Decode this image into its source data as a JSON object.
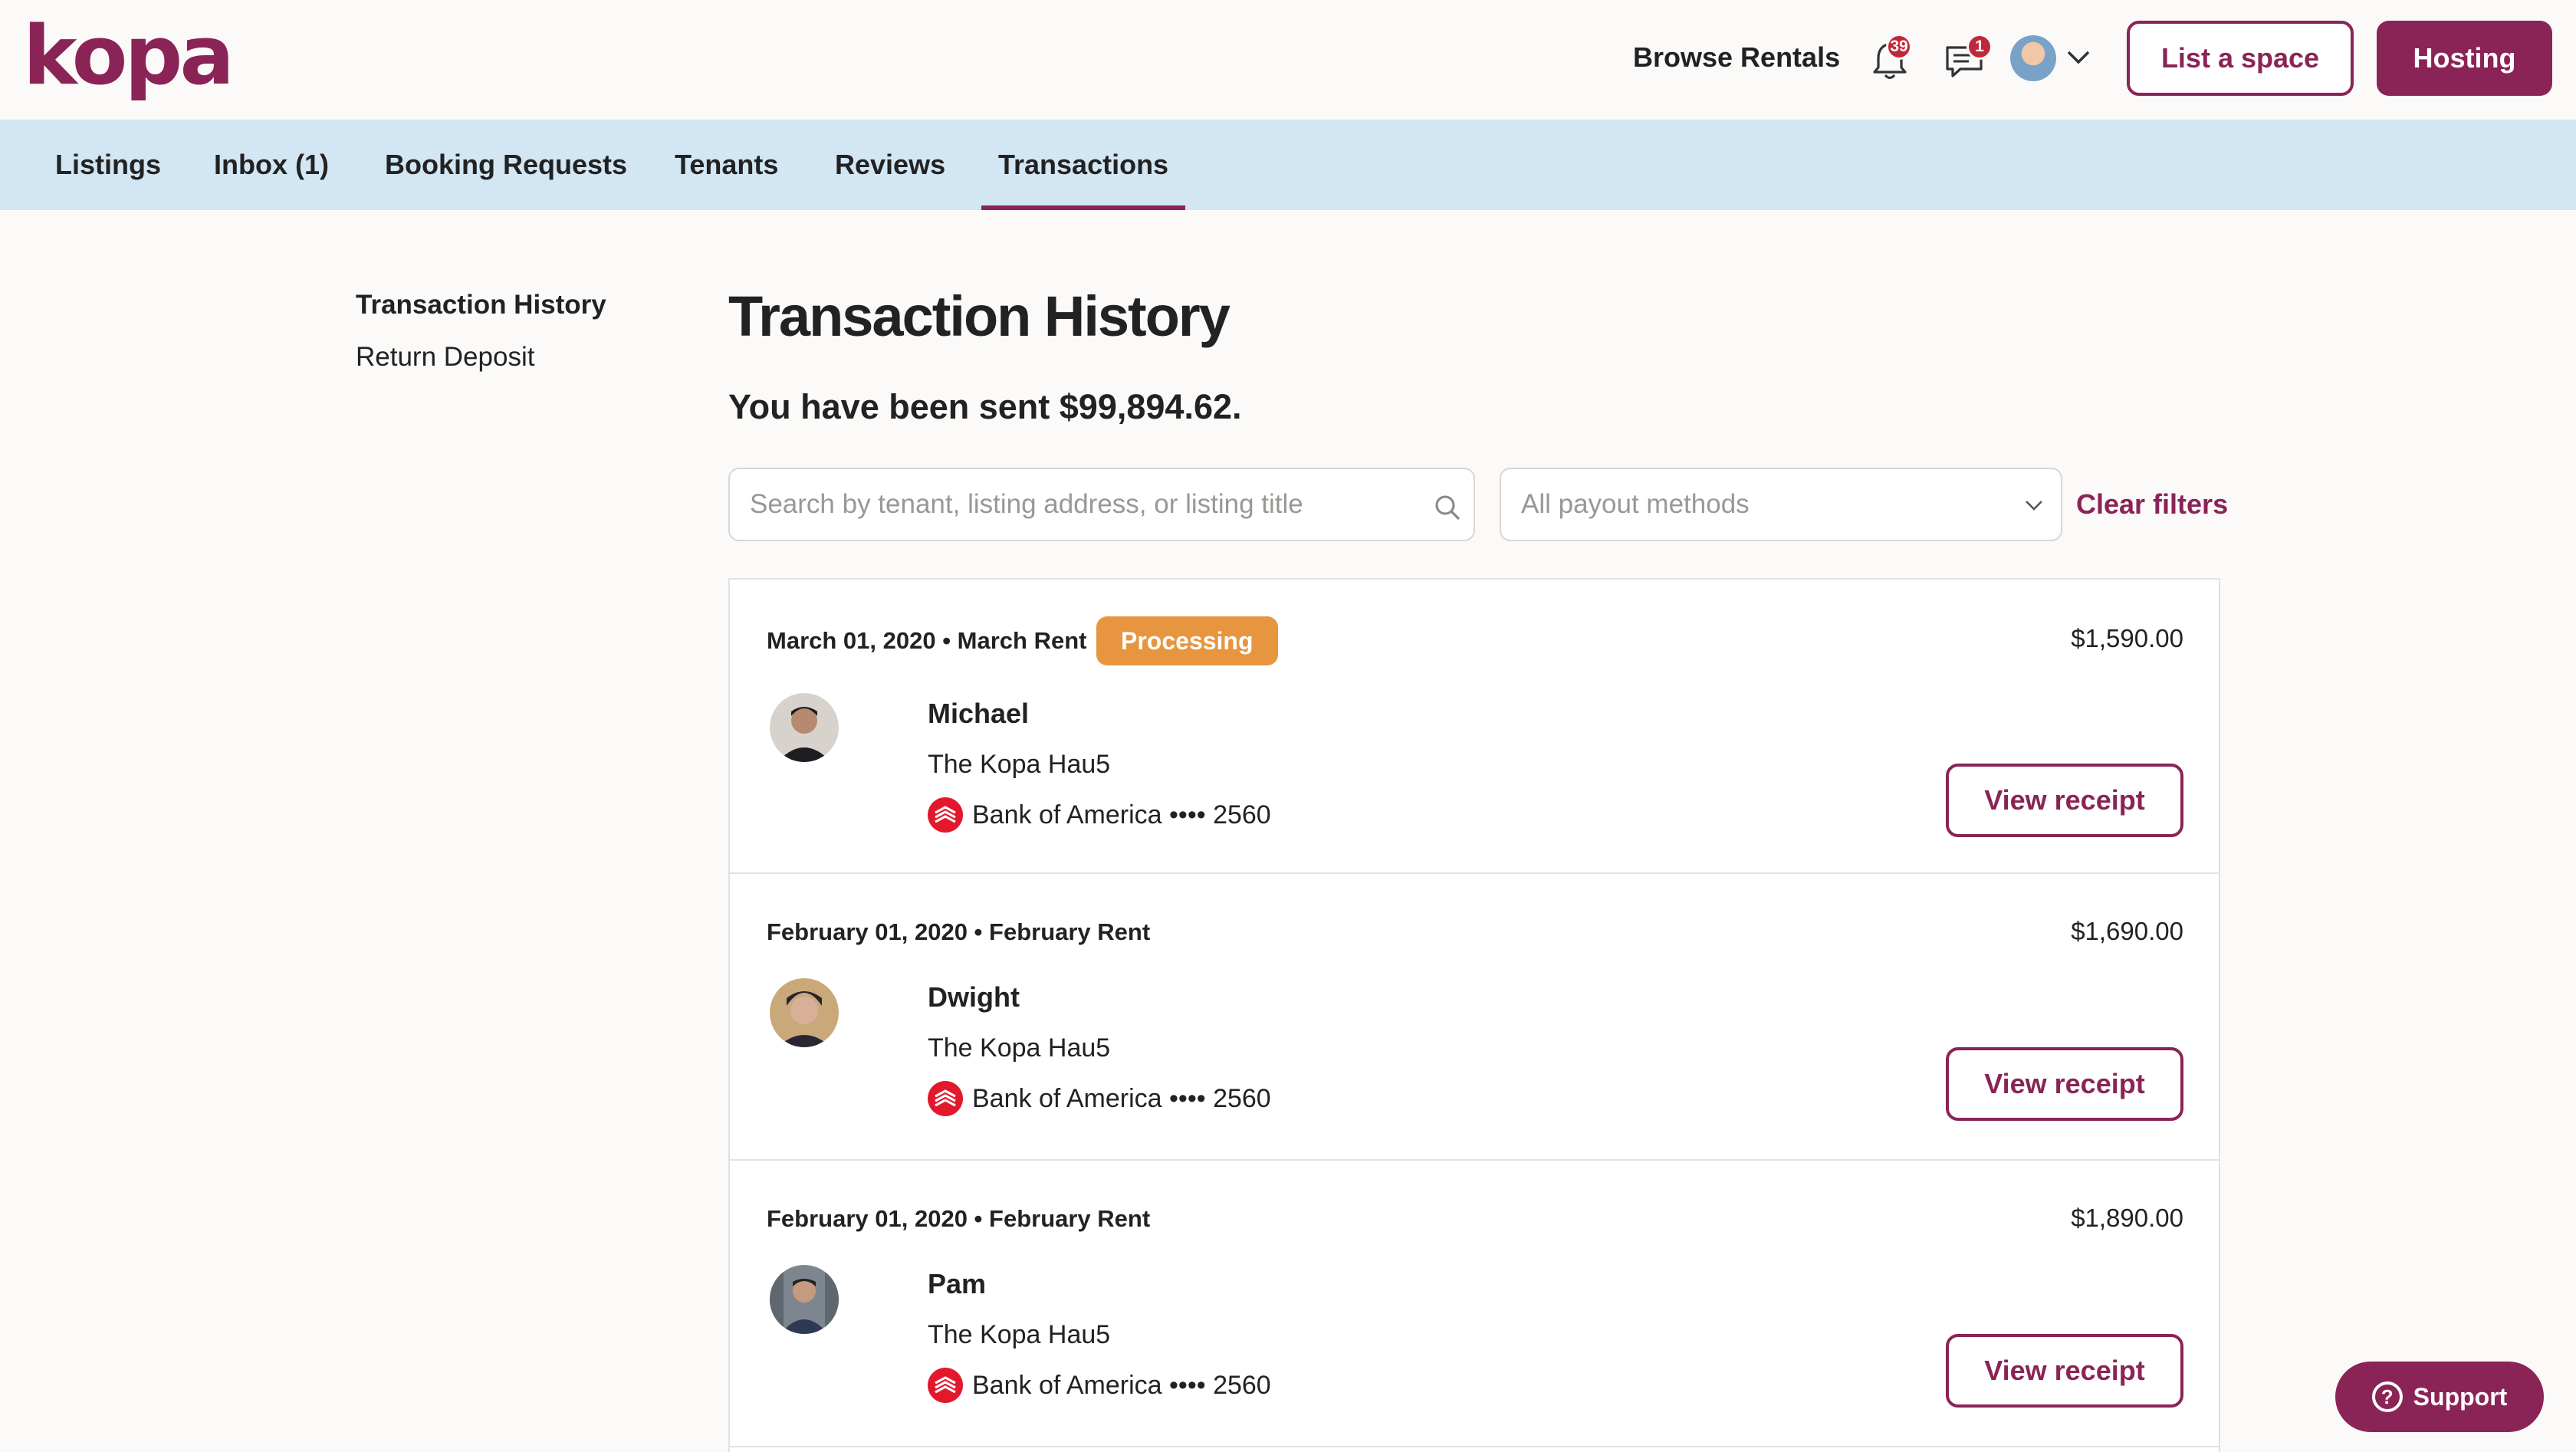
{
  "brand": {
    "logo_text": "kopa",
    "accent": "#8a2456"
  },
  "header": {
    "browse_label": "Browse Rentals",
    "notifications_count": "39",
    "messages_count": "1",
    "list_space_label": "List a space",
    "hosting_label": "Hosting"
  },
  "nav": {
    "tabs": [
      {
        "label": "Listings"
      },
      {
        "label": "Inbox (1)"
      },
      {
        "label": "Booking Requests"
      },
      {
        "label": "Tenants"
      },
      {
        "label": "Reviews"
      },
      {
        "label": "Transactions"
      }
    ],
    "active": "Transactions"
  },
  "sidebar": {
    "items": [
      {
        "label": "Transaction History"
      },
      {
        "label": "Return Deposit"
      }
    ]
  },
  "main": {
    "title": "Transaction History",
    "sent_summary": "You have been sent $99,894.62.",
    "search_placeholder": "Search by tenant, listing address, or listing title",
    "payout_select_value": "All payout methods",
    "clear_filters_label": "Clear filters"
  },
  "transactions": [
    {
      "meta": "March 01, 2020 • March Rent",
      "status": "Processing",
      "amount": "$1,590.00",
      "tenant": "Michael",
      "listing": "The Kopa Hau5",
      "payout": "Bank of America •••• 2560",
      "receipt_label": "View receipt"
    },
    {
      "meta": "February 01, 2020 • February Rent",
      "status": "",
      "amount": "$1,690.00",
      "tenant": "Dwight",
      "listing": "The Kopa Hau5",
      "payout": "Bank of America •••• 2560",
      "receipt_label": "View receipt"
    },
    {
      "meta": "February 01, 2020 • February Rent",
      "status": "",
      "amount": "$1,890.00",
      "tenant": "Pam",
      "listing": "The Kopa Hau5",
      "payout": "Bank of America •••• 2560",
      "receipt_label": "View receipt"
    }
  ],
  "support": {
    "label": "Support"
  },
  "colors": {
    "status_processing": "#e89540",
    "nav_bg": "#d2e6f4",
    "bank_red": "#e3182d"
  }
}
